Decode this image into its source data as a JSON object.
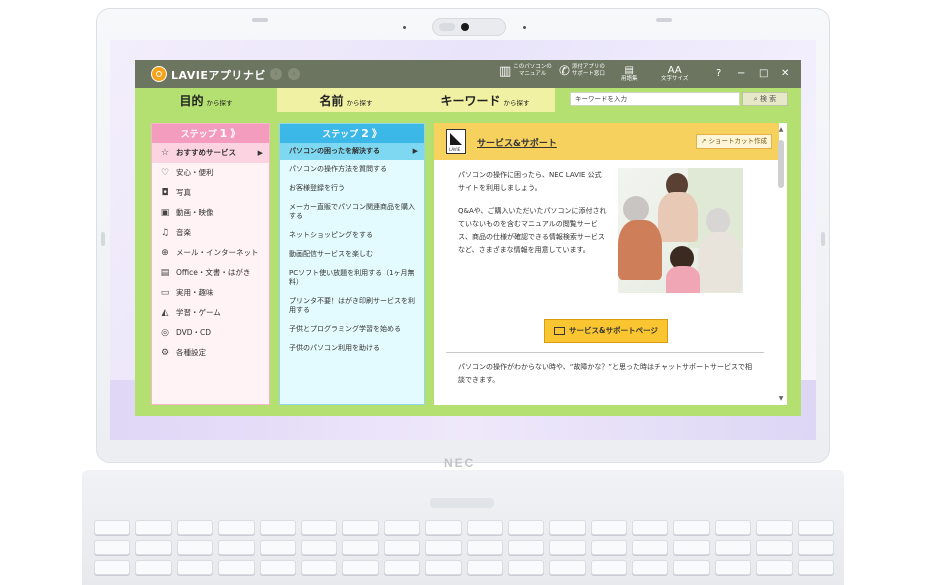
{
  "device": {
    "brand": "NEC"
  },
  "app": {
    "title": "LAVIEアプリナビ",
    "back_icon": "back-arrow-icon",
    "forward_icon": "forward-arrow-icon",
    "toolbar": [
      {
        "icon": "manual-book-icon",
        "label_line1": "このパソコンの",
        "label_line2": "マニュアル"
      },
      {
        "icon": "phone-icon",
        "label_line1": "添付アプリの",
        "label_line2": "サポート窓口"
      },
      {
        "icon": "glossary-icon",
        "label": "用語集"
      },
      {
        "icon": "font-size-icon",
        "glyph": "AA",
        "label": "文字サイズ"
      }
    ],
    "window_controls": {
      "help": "?",
      "minimize": "−",
      "maximize": "□",
      "close": "✕"
    }
  },
  "tabs": [
    {
      "main": "目的",
      "sub": "から探す",
      "active": true
    },
    {
      "main": "名前",
      "sub": "から探す",
      "active": false
    },
    {
      "main": "キーワード",
      "sub": "から探す",
      "active": false
    }
  ],
  "search": {
    "placeholder": "キーワードを入力",
    "button_label": "検 索"
  },
  "step1": {
    "label": "ステップ",
    "number": "1",
    "chevron": "》",
    "categories": [
      {
        "icon": "star-icon",
        "glyph": "☆",
        "label": "おすすめサービス",
        "selected": true,
        "arrow": "▶"
      },
      {
        "icon": "heart-icon",
        "glyph": "♡",
        "label": "安心・便利"
      },
      {
        "icon": "camera-icon",
        "glyph": "◘",
        "label": "写真"
      },
      {
        "icon": "video-icon",
        "glyph": "▣",
        "label": "動画・映像"
      },
      {
        "icon": "music-icon",
        "glyph": "♫",
        "label": "音楽"
      },
      {
        "icon": "globe-icon",
        "glyph": "⊕",
        "label": "メール・インターネット"
      },
      {
        "icon": "document-icon",
        "glyph": "▤",
        "label": "Office・文書・はがき"
      },
      {
        "icon": "toolbox-icon",
        "glyph": "▭",
        "label": "実用・趣味"
      },
      {
        "icon": "learning-icon",
        "glyph": "◭",
        "label": "学習・ゲーム"
      },
      {
        "icon": "disc-icon",
        "glyph": "◎",
        "label": "DVD・CD"
      },
      {
        "icon": "gear-icon",
        "glyph": "⚙",
        "label": "各種設定"
      }
    ]
  },
  "step2": {
    "label": "ステップ",
    "number": "2",
    "chevron": "》",
    "items": [
      {
        "label": "パソコンの困ったを解決する",
        "selected": true,
        "arrow": "▶"
      },
      {
        "label": "パソコンの操作方法を質問する"
      },
      {
        "label": "お客様登録を行う"
      },
      {
        "label": "メーカー直販でパソコン関連商品を購入する"
      },
      {
        "label": "ネットショッピングをする"
      },
      {
        "label": "動画配信サービスを楽しむ"
      },
      {
        "label": "PCソフト使い放題を利用する（1ヶ月無料）"
      },
      {
        "label": "プリンタ不要！はがき印刷サービスを利用する"
      },
      {
        "label": "子供とプログラミング学習を始める"
      },
      {
        "label": "子供のパソコン利用を助ける"
      }
    ]
  },
  "detail": {
    "icon_label": "LAVIE",
    "title": "サービス&サポート",
    "shortcut_label": "ショートカット作成",
    "para1": "パソコンの操作に困ったら、NEC LAVIE 公式サイトを利用しましょう。",
    "para2": "Q&Aや、ご購入いただいたパソコンに添付されていないものを含むマニュアルの閲覧サービス、商品の仕様が確認できる情報検索サービスなど、さまざまな情報を用意しています。",
    "button_label": "サービス&サポートページ",
    "para3": "パソコンの操作がわからない時や、“故障かな？”と思った時はチャットサポートサービスで相談できます。"
  }
}
